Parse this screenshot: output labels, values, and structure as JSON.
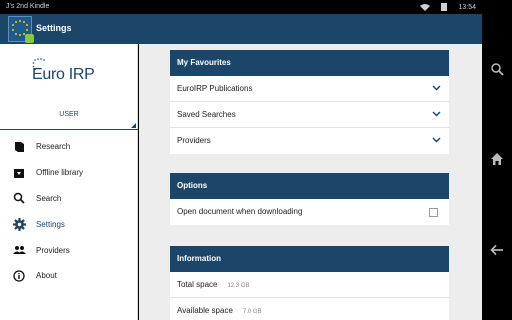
{
  "status_bar": {
    "device_name": "J's 2nd Kindle",
    "time": "13:54"
  },
  "app_bar": {
    "title": "Settings"
  },
  "drawer": {
    "logo_text": "Euro IRP",
    "user_label": "USER",
    "items": [
      {
        "label": "Research",
        "icon": "book-icon"
      },
      {
        "label": "Offline library",
        "icon": "archive-icon"
      },
      {
        "label": "Search",
        "icon": "search-icon"
      },
      {
        "label": "Settings",
        "icon": "gear-icon"
      },
      {
        "label": "Providers",
        "icon": "people-icon"
      },
      {
        "label": "About",
        "icon": "info-icon"
      }
    ]
  },
  "favourites": {
    "title": "My Favourites",
    "items": [
      "EuroIRP Publications",
      "Saved Searches",
      "Providers"
    ]
  },
  "options": {
    "title": "Options",
    "open_doc_label": "Open document when downloading",
    "open_doc_checked": false
  },
  "information": {
    "title": "Information",
    "rows": [
      {
        "label": "Total space",
        "value": "12.3 GB"
      },
      {
        "label": "Available space",
        "value": "7.0 GB"
      }
    ]
  },
  "colors": {
    "primary": "#1b4669",
    "background": "#ededed",
    "accent_green": "#8cc63f"
  }
}
